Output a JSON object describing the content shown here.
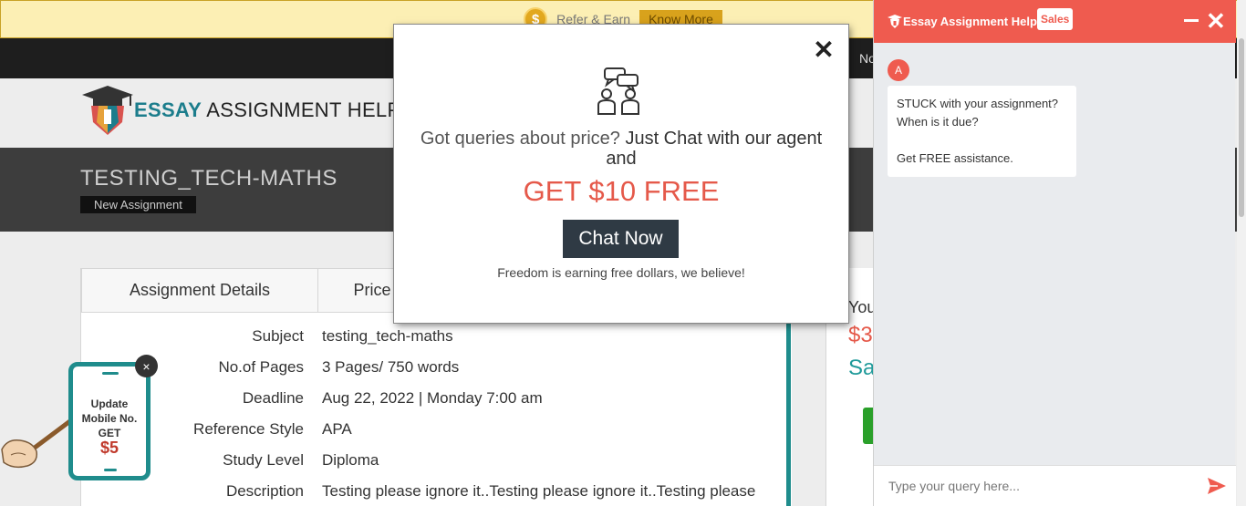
{
  "promo": {
    "coin_symbol": "$",
    "text": "Refer & Earn",
    "button": "Know More"
  },
  "nav": {
    "partial_text": "No"
  },
  "logo": {
    "bold": "ESSAY",
    "rest": " ASSIGNMENT HELP"
  },
  "page": {
    "title": "TESTING_TECH-MATHS",
    "badge": "New Assignment"
  },
  "tabs": [
    {
      "label": "Assignment Details"
    },
    {
      "label": "Price"
    }
  ],
  "details": [
    {
      "label": "Subject",
      "value": "testing_tech-maths"
    },
    {
      "label": "No.of Pages",
      "value": "3 Pages/ 750 words"
    },
    {
      "label": "Deadline",
      "value": "Aug 22, 2022 | Monday 7:00 am"
    },
    {
      "label": "Reference Style",
      "value": "APA"
    },
    {
      "label": "Study Level",
      "value": "Diploma"
    },
    {
      "label": "Description",
      "value": "Testing please ignore it..Testing please ignore it..Testing please"
    }
  ],
  "side": {
    "you": "You",
    "price": "$3",
    "sa": "Sa"
  },
  "mobile_widget": {
    "line1": "Update",
    "line2": "Mobile No.",
    "line3": "GET",
    "amount": "$5",
    "close": "×"
  },
  "modal": {
    "close": "✕",
    "line1_part1": "Got queries about price?",
    "line1_part2": " Just Chat with our agent",
    "line2": "and",
    "offer": "GET $10 FREE",
    "button": "Chat Now",
    "footer": "Freedom is earning free dollars, we believe!"
  },
  "chat": {
    "title": "Essay Assignment Help",
    "badge": "Sales",
    "close": "✕",
    "avatar": "A",
    "messages": [
      "STUCK with your assignment?",
      "When is it due?",
      "",
      "Get FREE assistance."
    ],
    "input_placeholder": "Type your query here...",
    "accent": "#ef5b4f"
  },
  "colors": {
    "accent_red": "#e5594a",
    "teal": "#1f8c8c",
    "dark_button": "#2f3a44"
  }
}
